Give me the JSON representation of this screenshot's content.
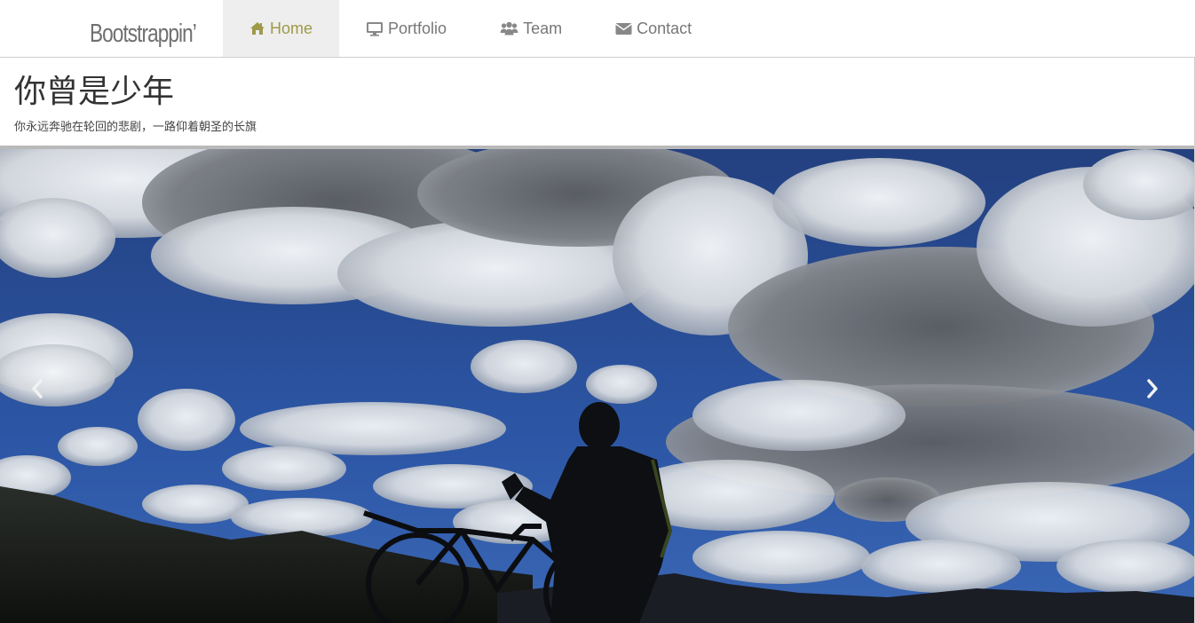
{
  "brand": {
    "name": "Bootstrappin’"
  },
  "nav": {
    "items": [
      {
        "label": "Home",
        "icon": "home-icon",
        "active": true
      },
      {
        "label": "Portfolio",
        "icon": "desktop-icon",
        "active": false
      },
      {
        "label": "Team",
        "icon": "users-icon",
        "active": false
      },
      {
        "label": "Contact",
        "icon": "envelope-icon",
        "active": false
      }
    ],
    "active_color": "#9e9a4a",
    "text_color": "#777777"
  },
  "header": {
    "title": "你曾是少年",
    "subtitle": "你永远奔驰在轮回的悲剧，一路仰着朝圣的长旗"
  },
  "carousel": {
    "prev_icon": "chevron-left-icon",
    "next_icon": "chevron-right-icon"
  }
}
